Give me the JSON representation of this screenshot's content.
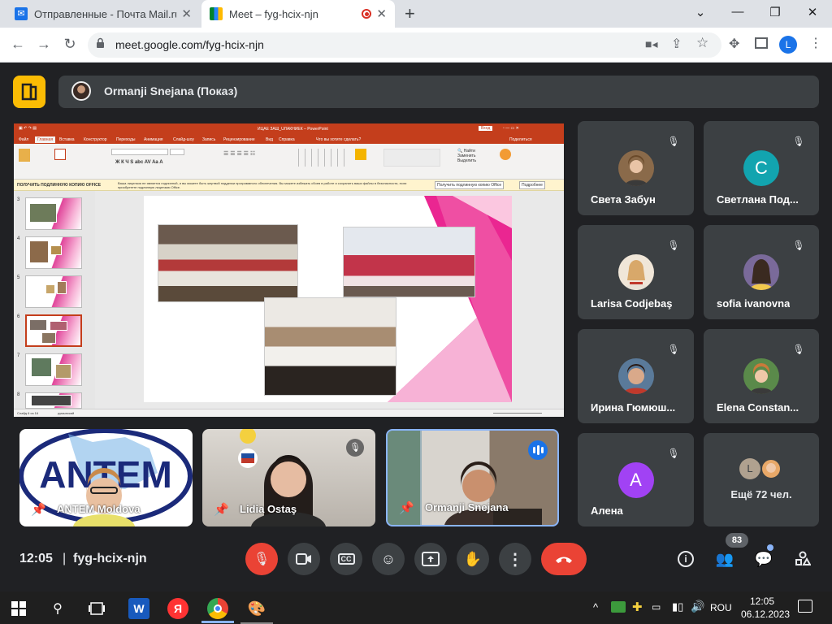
{
  "browser": {
    "tabs": [
      {
        "title": "Отправленные - Почта Mail.ru",
        "close": "✕"
      },
      {
        "title": "Meet – fyg-hcix-njn",
        "close": "✕"
      }
    ],
    "new_tab": "+",
    "url": "meet.google.com/fyg-hcix-njn",
    "profile_initial": "L"
  },
  "meet": {
    "presenter_bar": "Ormanji Snejana (Показ)",
    "time": "12:05",
    "meeting_code": "fyg-hcix-njn",
    "people_count": "83",
    "more_participants": "Ещё 72 чел.",
    "more_avatar_initial": "L",
    "participants": [
      {
        "name": "Света Забун",
        "avatar": "photo",
        "color": "#8a6a4a"
      },
      {
        "name": "Светлана Под...",
        "avatar": "С",
        "color": "#12a4af"
      },
      {
        "name": "Larisa Codjebaş",
        "avatar": "photo",
        "color": "#d8b79a"
      },
      {
        "name": "sofia ivanovna",
        "avatar": "photo",
        "color": "#7a6a9a"
      },
      {
        "name": "Ирина Гюмюш...",
        "avatar": "photo",
        "color": "#5a4a42"
      },
      {
        "name": "Elena Constan...",
        "avatar": "photo",
        "color": "#c98a4a"
      },
      {
        "name": "Алена",
        "avatar": "A",
        "color": "#a142f4"
      }
    ],
    "video_tiles": [
      {
        "name": "ANTEM Moldova",
        "logo": "ANTEM"
      },
      {
        "name": "Lidia Ostaş"
      },
      {
        "name": "Ormanji Snejana"
      }
    ]
  },
  "ppt": {
    "window_title": "ИЦАЕ ЗАШ_UЛАКНИЕК – PowerPoint",
    "login": "Вход",
    "menu": [
      "Файл",
      "Главная",
      "Вставка",
      "Конструктор",
      "Переходы",
      "Анимация",
      "Слайд-шоу",
      "Запись",
      "Рецензирование",
      "Вид",
      "Справка",
      "Что вы хотите сделать?"
    ],
    "share": "Поделиться",
    "warning_bold": "ПОЛУЧИТЬ ПОДЛИННУЮ КОПИЮ OFFICE",
    "warning_text": "Ваша лицензия не является подлинной, и вы можете быть жертвой подделки программного обеспечения. Вы можете избежать сбоев в работе и сохранить ваши файлы в безопасности, если приобретете подлинную лицензию Office.",
    "warning_btn1": "Получить подлинную копию Office",
    "warning_btn2": "Подробнее",
    "thumb_numbers": [
      "3",
      "4",
      "5",
      "6",
      "7",
      "8"
    ],
    "status_left": "Слайд 6 из 16",
    "status_lang": "румынский"
  },
  "taskbar": {
    "lang": "ROU",
    "time": "12:05",
    "date": "06.12.2023"
  }
}
